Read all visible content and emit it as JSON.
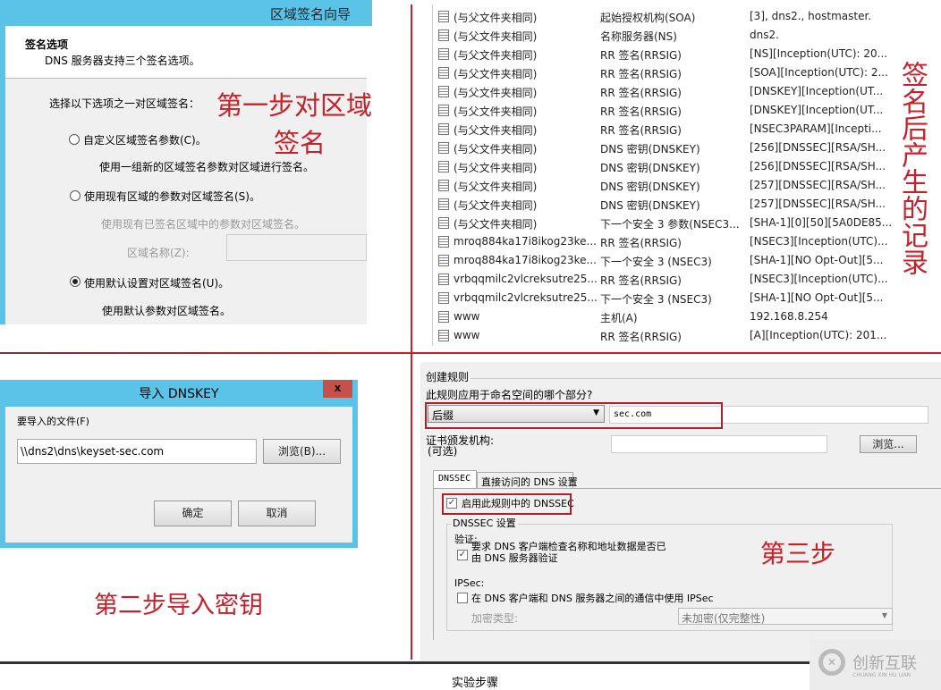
{
  "wizard": {
    "title": "区域签名向导",
    "section_title": "签名选项",
    "section_desc": "DNS 服务器支持三个签名选项。",
    "prompt": "选择以下选项之一对区域签名：",
    "options": [
      {
        "label": "自定义区域签名参数(C)。",
        "desc": "使用一组新的区域签名参数对区域进行签名。",
        "selected": false
      },
      {
        "label": "使用现有区域的参数对区域签名(S)。",
        "desc": "使用现有已签名区域中的参数对区域签名。",
        "selected": false
      },
      {
        "label": "使用默认设置对区域签名(U)。",
        "desc": "使用默认参数对区域签名。",
        "selected": true
      }
    ],
    "zone_name_label": "区域名称(Z):",
    "zone_name_value": ""
  },
  "annotations": {
    "step1_line1": "第一步对区域",
    "step1_line2": "签名",
    "step2": "第二步导入密钥",
    "step3": "第三步",
    "records_note": "签名后产生的记录"
  },
  "records": [
    [
      "(与父文件夹相同)",
      "起始授权机构(SOA)",
      "[3], dns2., hostmaster."
    ],
    [
      "(与父文件夹相同)",
      "名称服务器(NS)",
      "dns2."
    ],
    [
      "(与父文件夹相同)",
      "RR 签名(RRSIG)",
      "[NS][Inception(UTC): 20..."
    ],
    [
      "(与父文件夹相同)",
      "RR 签名(RRSIG)",
      "[SOA][Inception(UTC): 2..."
    ],
    [
      "(与父文件夹相同)",
      "RR 签名(RRSIG)",
      "[DNSKEY][Inception(UT..."
    ],
    [
      "(与父文件夹相同)",
      "RR 签名(RRSIG)",
      "[DNSKEY][Inception(UT..."
    ],
    [
      "(与父文件夹相同)",
      "RR 签名(RRSIG)",
      "[NSEC3PARAM][Incepti..."
    ],
    [
      "(与父文件夹相同)",
      "DNS 密钥(DNSKEY)",
      "[256][DNSSEC][RSA/SH..."
    ],
    [
      "(与父文件夹相同)",
      "DNS 密钥(DNSKEY)",
      "[256][DNSSEC][RSA/SH..."
    ],
    [
      "(与父文件夹相同)",
      "DNS 密钥(DNSKEY)",
      "[257][DNSSEC][RSA/SH..."
    ],
    [
      "(与父文件夹相同)",
      "DNS 密钥(DNSKEY)",
      "[257][DNSSEC][RSA/SH..."
    ],
    [
      "(与父文件夹相同)",
      "下一个安全 3 参数(NSEC3...",
      "[SHA-1][0][50][5A0DE85..."
    ],
    [
      "mroq884ka17i8ikog23ke...",
      "RR 签名(RRSIG)",
      "[NSEC3][Inception(UTC)..."
    ],
    [
      "mroq884ka17i8ikog23ke...",
      "下一个安全 3 (NSEC3)",
      "[SHA-1][NO Opt-Out][5..."
    ],
    [
      "vrbqqmilc2vlcreksutre25...",
      "RR 签名(RRSIG)",
      "[NSEC3][Inception(UTC)..."
    ],
    [
      "vrbqqmilc2vlcreksutre25...",
      "下一个安全 3 (NSEC3)",
      "[SHA-1][NO Opt-Out][5..."
    ],
    [
      "www",
      "主机(A)",
      "192.168.8.254"
    ],
    [
      "www",
      "RR 签名(RRSIG)",
      "[A][Inception(UTC): 201..."
    ]
  ],
  "import": {
    "title": "导入 DNSKEY",
    "close": "x",
    "file_label": "要导入的文件(F)",
    "file_value": "\\\\dns2\\dns\\keyset-sec.com",
    "browse": "浏览(B)...",
    "ok": "确定",
    "cancel": "取消"
  },
  "rule": {
    "group": "创建规则",
    "question": "此规则应用于命名空间的哪个部分?",
    "namespace_type": "后缀",
    "namespace_value": "sec.com",
    "ca_label": "证书颁发机构:",
    "ca_optional": "(可选)",
    "ca_value": "",
    "browse": "浏览...",
    "tabs": [
      "DNSSEC",
      "直接访问的 DNS 设置"
    ],
    "enable_dnssec": "启用此规则中的 DNSSEC",
    "enable_checked": true,
    "settings_group": "DNSSEC 设置",
    "validation_label": "验证:",
    "validation_text1": "要求 DNS 客户端检查名称和地址数据是否已",
    "validation_text2": "由 DNS 服务器验证",
    "validation_checked": true,
    "ipsec_label": "IPSec:",
    "ipsec_text": "在 DNS 客户端和 DNS 服务器之间的通信中使用 IPSec",
    "ipsec_checked": false,
    "encryption_label": "加密类型:",
    "encryption_value": "未加密(仅完整性)"
  },
  "caption": "实验步骤",
  "watermark": {
    "name": "创新互联",
    "sub": "CHUANG XIN HU LIAN"
  }
}
